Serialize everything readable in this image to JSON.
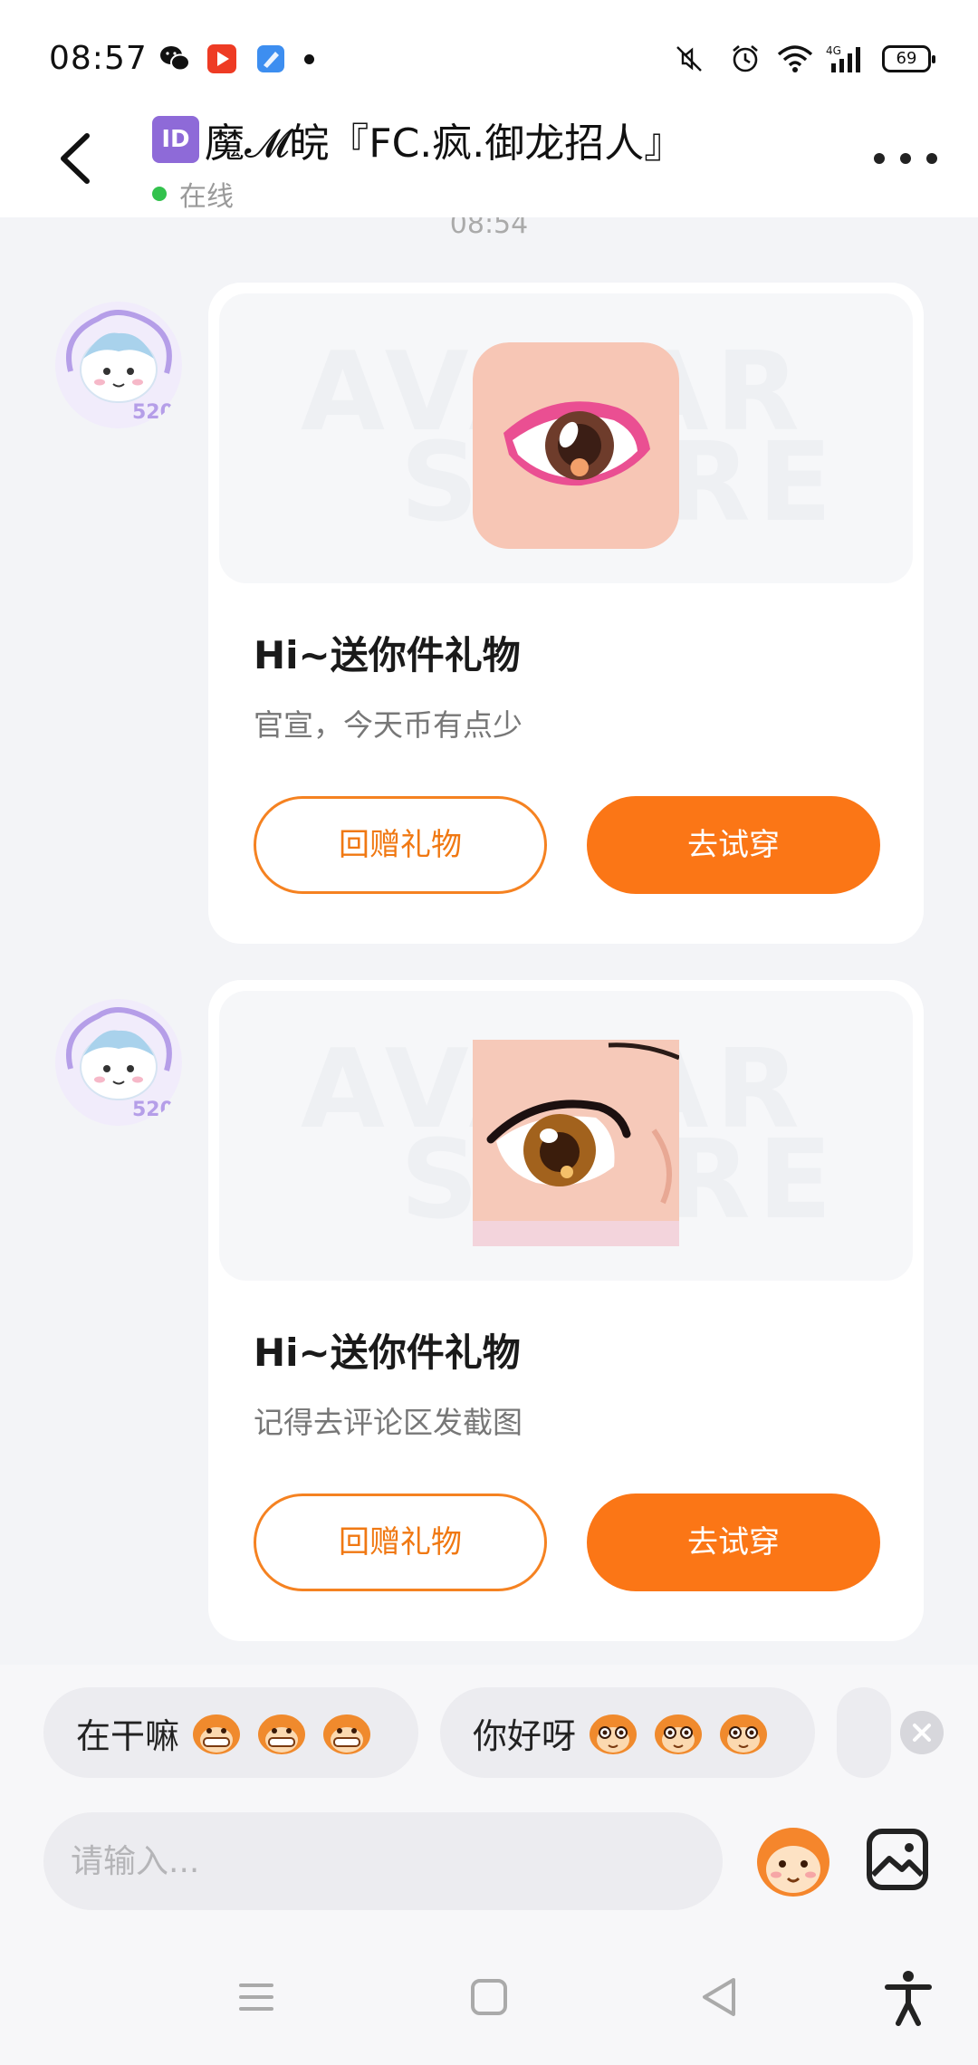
{
  "status_bar": {
    "time": "08:57",
    "network": "4G",
    "battery": "69",
    "icons": [
      "wechat-icon",
      "video-app-icon",
      "app-icon",
      "mute-icon",
      "alarm-icon",
      "wifi-icon",
      "signal-icon"
    ]
  },
  "header": {
    "badge": "ID",
    "title": "魔𝓜皖『FC.疯.御龙招人』",
    "status": "在线"
  },
  "chat": {
    "timestamp": "08:54",
    "watermark_line1": "AVATAR",
    "watermark_line2": "STORE",
    "messages": [
      {
        "title": "Hi~送你件礼物",
        "desc": "官宣，今天币有点少",
        "return_gift_label": "回赠礼物",
        "try_on_label": "去试穿"
      },
      {
        "title": "Hi~送你件礼物",
        "desc": "记得去评论区发截图",
        "return_gift_label": "回赠礼物",
        "try_on_label": "去试穿"
      }
    ]
  },
  "quick_replies": [
    {
      "text": "在干嘛"
    },
    {
      "text": "你好呀"
    }
  ],
  "input": {
    "placeholder": "请输入..."
  },
  "colors": {
    "accent": "#fb7616",
    "online": "#33c24d",
    "background": "#f3f4f7"
  }
}
